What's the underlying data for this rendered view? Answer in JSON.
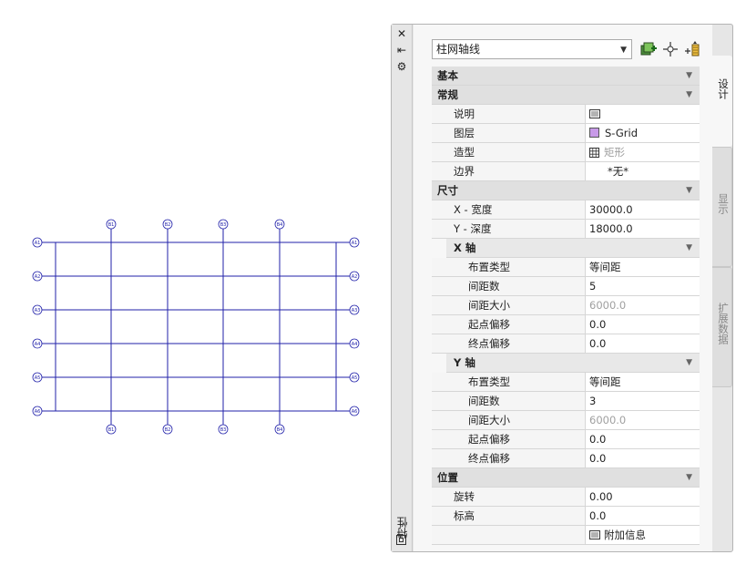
{
  "drawing": {
    "top_labels": [
      "B1",
      "B2",
      "B3",
      "B4"
    ],
    "bottom_labels": [
      "B1",
      "B2",
      "B3",
      "B4"
    ],
    "left_labels": [
      "A1",
      "A2",
      "A3",
      "A4",
      "A5",
      "A6"
    ],
    "right_labels": [
      "A1",
      "A2",
      "A3",
      "A4",
      "A5",
      "A6"
    ],
    "line_color": "#2222aa"
  },
  "palette": {
    "title": "特性",
    "close_glyph": "✕",
    "pin_glyph": "⇤",
    "settings_glyph": "⚙",
    "style_value": "柱网轴线",
    "icons": [
      "add-style-icon",
      "pick-point-icon",
      "quick-select-icon"
    ],
    "tabs": [
      "设计",
      "显示",
      "扩展数据"
    ]
  },
  "sections": {
    "basic": "基本",
    "general": "常规",
    "dimensions": "尺寸",
    "x_axis": "X 轴",
    "y_axis": "Y 轴",
    "location": "位置"
  },
  "props": {
    "description": {
      "label": "说明",
      "value": ""
    },
    "layer": {
      "label": "图层",
      "value": "S-Grid"
    },
    "shape": {
      "label": "造型",
      "value": "矩形"
    },
    "boundary": {
      "label": "边界",
      "value": "*无*"
    },
    "x_width": {
      "label": "X - 宽度",
      "value": "30000.0"
    },
    "y_depth": {
      "label": "Y - 深度",
      "value": "18000.0"
    },
    "x_layout": {
      "label": "布置类型",
      "value": "等间距"
    },
    "x_count": {
      "label": "间距数",
      "value": "5"
    },
    "x_size": {
      "label": "间距大小",
      "value": "6000.0"
    },
    "x_start": {
      "label": "起点偏移",
      "value": "0.0"
    },
    "x_end": {
      "label": "终点偏移",
      "value": "0.0"
    },
    "y_layout": {
      "label": "布置类型",
      "value": "等间距"
    },
    "y_count": {
      "label": "间距数",
      "value": "3"
    },
    "y_size": {
      "label": "间距大小",
      "value": "6000.0"
    },
    "y_start": {
      "label": "起点偏移",
      "value": "0.0"
    },
    "y_end": {
      "label": "终点偏移",
      "value": "0.0"
    },
    "rotation": {
      "label": "旋转",
      "value": "0.00"
    },
    "elevation": {
      "label": "标高",
      "value": "0.0"
    },
    "additional": {
      "label": "",
      "value": "附加信息"
    }
  },
  "colors": {
    "layer_swatch": "#c89ae8",
    "disabled_text": "#a0a0a0"
  }
}
